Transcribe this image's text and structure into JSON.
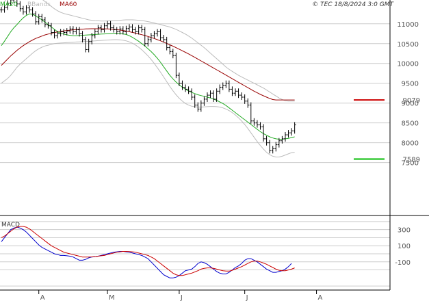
{
  "chart_data": [
    {
      "type": "ohlc",
      "panel": "price",
      "legend": [
        {
          "label": "MA20",
          "color": "#22aa22"
        },
        {
          "label": "BBands",
          "color": "#bbbbbb"
        },
        {
          "label": "MA60",
          "color": "#990000"
        }
      ],
      "credit": "© TEC 18/8/2024 3:0 GMT",
      "y_ticks": [
        7500,
        8000,
        8500,
        9000,
        9500,
        10000,
        10500,
        11000
      ],
      "ylim": [
        6200,
        11600
      ],
      "grid": true,
      "price_labels": [
        {
          "label": "9079",
          "value": 9079,
          "color": "#990000"
        },
        {
          "label": "7589",
          "value": 7589,
          "color": "#008800"
        }
      ],
      "sessions": 114,
      "close": [
        11350,
        11420,
        11520,
        11600,
        11650,
        11500,
        11380,
        11300,
        11400,
        11350,
        11250,
        11050,
        11180,
        11100,
        10980,
        10950,
        10780,
        10700,
        10750,
        10800,
        10780,
        10820,
        10870,
        10800,
        10850,
        10750,
        10600,
        10350,
        10550,
        10700,
        10800,
        10900,
        10850,
        10950,
        11000,
        10900,
        10850,
        10800,
        10870,
        10800,
        10880,
        10920,
        10850,
        10800,
        10900,
        10850,
        10500,
        10600,
        10700,
        10750,
        10800,
        10650,
        10600,
        10400,
        10300,
        10200,
        9700,
        9500,
        9400,
        9350,
        9300,
        9150,
        8950,
        8850,
        9000,
        9100,
        9200,
        9250,
        9100,
        9300,
        9400,
        9450,
        9500,
        9350,
        9250,
        9300,
        9200,
        9150,
        9050,
        8950,
        8550,
        8500,
        8450,
        8400,
        8100,
        8000,
        7800,
        7850,
        7950,
        8050,
        8100,
        8200,
        8250,
        8300,
        8450
      ],
      "ma20": [
        10450,
        10560,
        10680,
        10800,
        10900,
        10980,
        11070,
        11150,
        11210,
        11250,
        11240,
        11200,
        11150,
        11100,
        11040,
        10980,
        10920,
        10860,
        10800,
        10760,
        10740,
        10720,
        10710,
        10700,
        10700,
        10705,
        10710,
        10715,
        10720,
        10725,
        10730,
        10735,
        10740,
        10745,
        10750,
        10755,
        10760,
        10762,
        10755,
        10745,
        10730,
        10700,
        10660,
        10610,
        10560,
        10500,
        10440,
        10370,
        10300,
        10220,
        10130,
        10030,
        9920,
        9810,
        9700,
        9610,
        9530,
        9460,
        9400,
        9350,
        9305,
        9270,
        9240,
        9210,
        9190,
        9170,
        9150,
        9130,
        9100,
        9070,
        9030,
        8990,
        8940,
        8880,
        8820,
        8760,
        8700,
        8640,
        8580,
        8520,
        8460,
        8400,
        8340,
        8280,
        8230,
        8190,
        8150,
        8120,
        8100,
        8090,
        8090,
        8100,
        8110,
        8130,
        8150
      ],
      "ma60": [
        9950,
        10030,
        10110,
        10190,
        10260,
        10330,
        10390,
        10450,
        10500,
        10550,
        10590,
        10630,
        10660,
        10690,
        10720,
        10740,
        10760,
        10780,
        10795,
        10810,
        10820,
        10830,
        10840,
        10848,
        10855,
        10860,
        10865,
        10870,
        10873,
        10875,
        10876,
        10876,
        10875,
        10873,
        10870,
        10866,
        10860,
        10852,
        10842,
        10830,
        10816,
        10800,
        10783,
        10765,
        10745,
        10725,
        10705,
        10680,
        10655,
        10628,
        10600,
        10570,
        10538,
        10505,
        10470,
        10435,
        10398,
        10360,
        10320,
        10280,
        10240,
        10198,
        10155,
        10110,
        10065,
        10020,
        9975,
        9930,
        9885,
        9840,
        9795,
        9750,
        9705,
        9660,
        9615,
        9570,
        9525,
        9480,
        9435,
        9390,
        9345,
        9300,
        9260,
        9220,
        9185,
        9150,
        9118,
        9090,
        9079,
        9079,
        9079,
        9079,
        9079,
        9079,
        9079
      ],
      "bb_upper": [
        11400,
        11550,
        11700,
        11850,
        11950,
        12000,
        12020,
        12000,
        11960,
        11900,
        11820,
        11740,
        11680,
        11620,
        11560,
        11500,
        11440,
        11380,
        11330,
        11290,
        11260,
        11240,
        11220,
        11200,
        11180,
        11160,
        11140,
        11120,
        11100,
        11090,
        11080,
        11075,
        11070,
        11070,
        11072,
        11075,
        11080,
        11085,
        11090,
        11095,
        11100,
        11100,
        11100,
        11095,
        11090,
        11080,
        11070,
        11055,
        11040,
        11020,
        11000,
        10980,
        10960,
        10940,
        10920,
        10890,
        10860,
        10820,
        10780,
        10740,
        10690,
        10640,
        10580,
        10520,
        10460,
        10400,
        10330,
        10260,
        10190,
        10120,
        10050,
        9980,
        9910,
        9850,
        9800,
        9750,
        9700,
        9660,
        9620,
        9580,
        9540,
        9500,
        9460,
        9420,
        9380,
        9330,
        9280,
        9230,
        9180,
        9130,
        9090,
        9060,
        9050,
        9050,
        9050
      ],
      "bb_lower": [
        9500,
        9560,
        9620,
        9700,
        9800,
        9900,
        9980,
        10050,
        10120,
        10190,
        10260,
        10320,
        10370,
        10410,
        10440,
        10460,
        10480,
        10500,
        10510,
        10515,
        10520,
        10525,
        10530,
        10535,
        10540,
        10545,
        10550,
        10555,
        10560,
        10565,
        10570,
        10575,
        10580,
        10585,
        10590,
        10595,
        10600,
        10600,
        10595,
        10585,
        10570,
        10545,
        10510,
        10465,
        10410,
        10345,
        10270,
        10190,
        10100,
        10000,
        9890,
        9780,
        9660,
        9540,
        9420,
        9310,
        9210,
        9120,
        9050,
        8990,
        8950,
        8920,
        8910,
        8900,
        8900,
        8905,
        8910,
        8915,
        8915,
        8910,
        8900,
        8880,
        8850,
        8810,
        8760,
        8700,
        8630,
        8550,
        8460,
        8360,
        8250,
        8140,
        8030,
        7930,
        7840,
        7760,
        7700,
        7660,
        7640,
        7640,
        7660,
        7690,
        7720,
        7750,
        7760
      ]
    },
    {
      "type": "line",
      "panel": "macd",
      "title": "MACD",
      "y_ticks": [
        "300",
        "100",
        "-100"
      ],
      "y_tick_values": [
        300,
        100,
        -100
      ],
      "ylim": [
        -450,
        450
      ],
      "series": [
        {
          "color": "#0000cc",
          "values": [
            150,
            200,
            250,
            300,
            320,
            330,
            320,
            300,
            270,
            230,
            190,
            150,
            110,
            80,
            60,
            40,
            20,
            0,
            -10,
            -20,
            -20,
            -25,
            -30,
            -40,
            -60,
            -80,
            -80,
            -70,
            -50,
            -40,
            -35,
            -30,
            -20,
            -10,
            0,
            10,
            20,
            25,
            30,
            30,
            25,
            20,
            10,
            0,
            -10,
            -20,
            -40,
            -60,
            -100,
            -140,
            -180,
            -220,
            -260,
            -280,
            -300,
            -300,
            -290,
            -270,
            -240,
            -210,
            -200,
            -190,
            -160,
            -120,
            -100,
            -110,
            -130,
            -160,
            -190,
            -220,
            -240,
            -250,
            -250,
            -230,
            -200,
            -170,
            -150,
            -120,
            -80,
            -60,
            -60,
            -80,
            -100,
            -130,
            -160,
            -190,
            -210,
            -230,
            -230,
            -220,
            -210,
            -190,
            -160,
            -120
          ]
        },
        {
          "color": "#cc0000",
          "values": [
            200,
            220,
            250,
            280,
            310,
            330,
            340,
            340,
            330,
            310,
            280,
            250,
            220,
            190,
            160,
            130,
            100,
            80,
            60,
            40,
            20,
            10,
            0,
            -10,
            -20,
            -30,
            -40,
            -40,
            -40,
            -38,
            -35,
            -30,
            -25,
            -20,
            -10,
            0,
            10,
            20,
            25,
            30,
            30,
            28,
            25,
            20,
            10,
            0,
            -10,
            -20,
            -40,
            -60,
            -90,
            -120,
            -150,
            -180,
            -210,
            -240,
            -260,
            -270,
            -270,
            -260,
            -250,
            -240,
            -225,
            -210,
            -190,
            -180,
            -175,
            -175,
            -180,
            -190,
            -200,
            -210,
            -215,
            -215,
            -205,
            -190,
            -175,
            -160,
            -140,
            -120,
            -100,
            -90,
            -90,
            -100,
            -115,
            -130,
            -150,
            -170,
            -190,
            -205,
            -210,
            -210,
            -200,
            -190,
            -175
          ]
        }
      ]
    }
  ],
  "x_ticks": [
    {
      "label": "A",
      "index": 12
    },
    {
      "label": "M",
      "index": 34
    },
    {
      "label": "J",
      "index": 57
    },
    {
      "label": "J",
      "index": 78
    },
    {
      "label": "A",
      "index": 101
    }
  ]
}
